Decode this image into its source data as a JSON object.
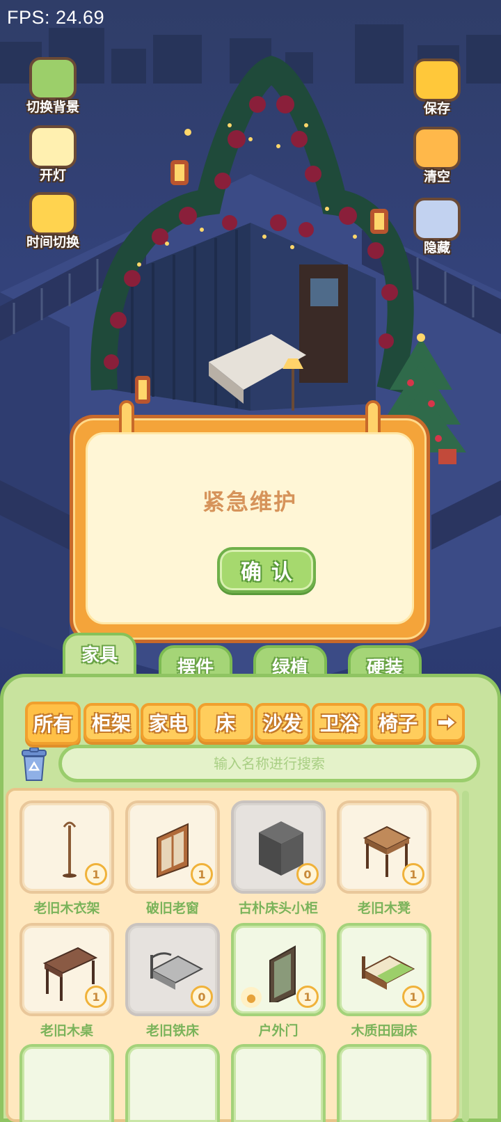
{
  "hud": {
    "fps": "FPS: 24.69"
  },
  "left_buttons": [
    {
      "label": "切换背景",
      "icon": "green-scroll-icon"
    },
    {
      "label": "开灯",
      "icon": "lamp-icon"
    },
    {
      "label": "时间切换",
      "icon": "sun-moon-icon"
    }
  ],
  "right_buttons": [
    {
      "label": "保存",
      "icon": "duck-save-icon"
    },
    {
      "label": "清空",
      "icon": "duck-clear-icon"
    },
    {
      "label": "隐藏",
      "icon": "hide-frame-icon"
    }
  ],
  "dialog": {
    "title": "紧急维护",
    "confirm_label": "确认"
  },
  "main_tabs": [
    {
      "label": "家具",
      "active": true
    },
    {
      "label": "摆件",
      "active": false
    },
    {
      "label": "绿植",
      "active": false
    },
    {
      "label": "硬装",
      "active": false
    }
  ],
  "sub_tabs": [
    {
      "label": "所有",
      "active": true
    },
    {
      "label": "柜架"
    },
    {
      "label": "家电"
    },
    {
      "label": "床"
    },
    {
      "label": "沙发"
    },
    {
      "label": "卫浴"
    },
    {
      "label": "椅子"
    }
  ],
  "search": {
    "placeholder": "输入名称进行搜索"
  },
  "items": [
    {
      "name": "老旧木衣架",
      "count": "1",
      "style": "beige",
      "icon": "coat-rack-icon"
    },
    {
      "name": "破旧老窗",
      "count": "1",
      "style": "beige",
      "icon": "window-icon"
    },
    {
      "name": "古朴床头小柜",
      "count": "0",
      "style": "gray",
      "icon": "nightstand-icon"
    },
    {
      "name": "老旧木凳",
      "count": "1",
      "style": "beige",
      "icon": "stool-icon"
    },
    {
      "name": "老旧木桌",
      "count": "1",
      "style": "beige",
      "icon": "desk-icon"
    },
    {
      "name": "老旧铁床",
      "count": "0",
      "style": "gray",
      "icon": "iron-bed-icon"
    },
    {
      "name": "户外门",
      "count": "1",
      "style": "green",
      "icon": "door-icon"
    },
    {
      "name": "木质田园床",
      "count": "1",
      "style": "green",
      "icon": "wooden-bed-icon"
    }
  ],
  "colors": {
    "panel_green": "#c8e39e",
    "tab_orange": "#ffcd5c",
    "dialog_orange": "#f4a43a",
    "confirm_green": "#a6d96e"
  }
}
